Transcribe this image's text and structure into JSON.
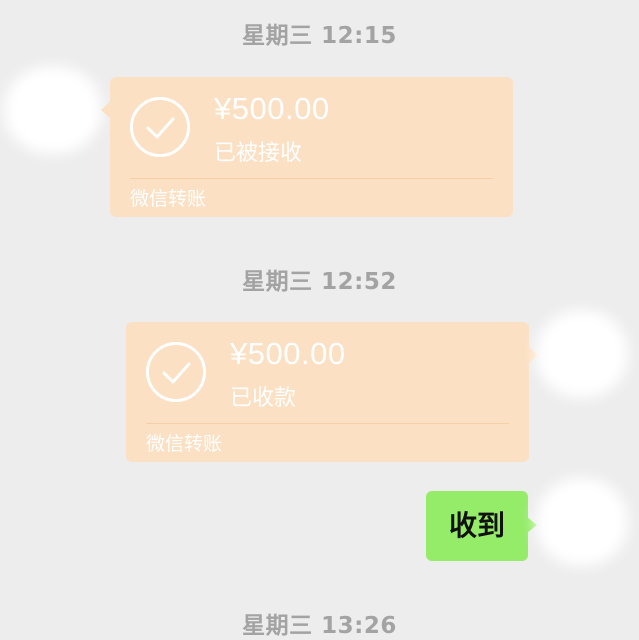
{
  "timestamps": [
    "星期三 12:15",
    "星期三 12:52",
    "星期三 13:26"
  ],
  "messages": [
    {
      "type": "transfer",
      "sender": "other",
      "amount": "¥500.00",
      "status": "已被接收",
      "brand": "微信转账",
      "icon": "check-circle-icon"
    },
    {
      "type": "transfer",
      "sender": "self",
      "amount": "¥500.00",
      "status": "已收款",
      "brand": "微信转账",
      "icon": "check-circle-icon"
    },
    {
      "type": "text",
      "sender": "self",
      "text": "收到"
    }
  ],
  "colors": {
    "background": "#ededed",
    "transfer_card": "#fbe0c3",
    "self_text_bubble": "#95ec69",
    "timestamp_text": "#a3a3a3"
  }
}
